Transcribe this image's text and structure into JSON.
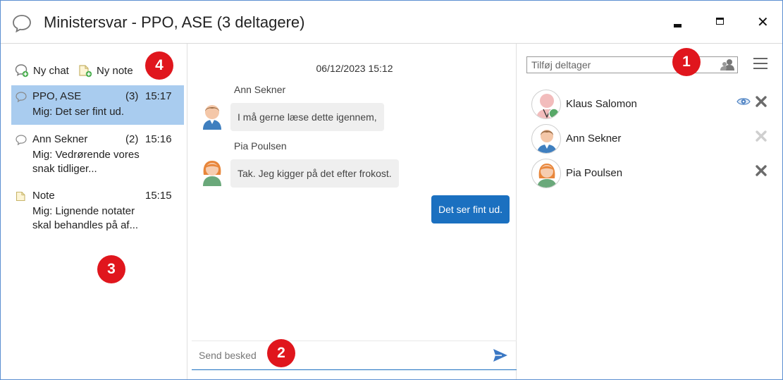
{
  "window": {
    "title": "Ministersvar - PPO, ASE (3 deltagere)",
    "controls": {
      "minimize": "minimize-icon",
      "maximize": "maximize-icon",
      "close": "✕"
    }
  },
  "left": {
    "new_chat_label": "Ny chat",
    "new_note_label": "Ny note",
    "conversations": [
      {
        "name": "PPO, ASE",
        "count": "(3)",
        "time": "15:17",
        "preview": "Mig: Det ser fint ud.",
        "type": "chat",
        "selected": true
      },
      {
        "name": "Ann Sekner",
        "count": "(2)",
        "time": "15:16",
        "preview": "Mig: Vedrørende vores snak tidliger...",
        "type": "chat",
        "selected": false
      },
      {
        "name": "Note",
        "count": "",
        "time": "15:15",
        "preview": "Mig: Lignende notater skal behandles på af...",
        "type": "note",
        "selected": false
      }
    ]
  },
  "chat": {
    "date": "06/12/2023 15:12",
    "messages": [
      {
        "sender": "Ann Sekner",
        "text": "I må gerne læse dette igennem,",
        "mine": false
      },
      {
        "sender": "Pia Poulsen",
        "text": "Tak. Jeg kigger på det efter frokost.",
        "mine": false
      },
      {
        "sender": "",
        "text": "Det ser fint ud.",
        "mine": true
      }
    ],
    "composer_placeholder": "Send besked"
  },
  "participants": {
    "add_placeholder": "Tilføj deltager",
    "list": [
      {
        "name": "Klaus Salomon",
        "watching": true,
        "removable": true
      },
      {
        "name": "Ann Sekner",
        "watching": false,
        "removable": false
      },
      {
        "name": "Pia Poulsen",
        "watching": false,
        "removable": true
      }
    ]
  },
  "callouts": [
    "1",
    "2",
    "3",
    "4"
  ],
  "colors": {
    "accent": "#1b70c0",
    "selected_row": "#a9ccef",
    "callout": "#e0161d",
    "bubble_other": "#efefef"
  }
}
